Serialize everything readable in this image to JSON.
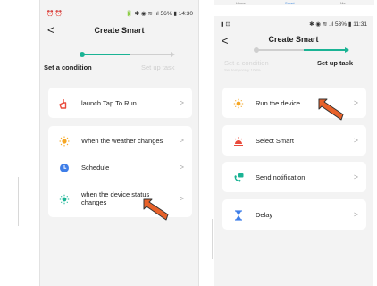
{
  "top_nav": {
    "home": "Home",
    "smart": "Smart",
    "me": "Me"
  },
  "left_phone": {
    "status_left": "⏰ ⏰",
    "status_right": "🔋 ✱ ◉ ≋ .ıl 56% ▮ 14:30",
    "back_glyph": "<",
    "title": "Create Smart",
    "steps": {
      "step1": "Set a condition",
      "step2": "Set up task"
    },
    "cards": [
      {
        "items": [
          {
            "label": "launch Tap To Run",
            "icon": "tap-hand-icon"
          }
        ]
      },
      {
        "items": [
          {
            "label": "When the weather changes",
            "icon": "sun-icon"
          },
          {
            "label": "Schedule",
            "icon": "clock-icon"
          },
          {
            "label": "when the device status changes",
            "icon": "device-icon"
          }
        ]
      }
    ],
    "chevron": ">"
  },
  "right_phone": {
    "status_left": "▮ ⊡",
    "status_right": "✱ ◉ ≋ .ıl 53% ▮ 11:31",
    "back_glyph": "<",
    "title": "Create Smart",
    "steps": {
      "step1": "Set a condition",
      "step1_sub": "Set temporary 100%",
      "step2": "Set up task"
    },
    "cards": [
      {
        "label": "Run the device",
        "icon": "device-icon"
      },
      {
        "label": "Select Smart",
        "icon": "smart-scene-icon"
      },
      {
        "label": "Send notification",
        "icon": "notification-icon"
      },
      {
        "label": "Delay",
        "icon": "hourglass-icon"
      }
    ],
    "chevron": ">"
  },
  "colors": {
    "accent": "#1ab394",
    "orange": "#f5a623",
    "red": "#e94b3c",
    "blue": "#3f7ee8",
    "pointer": "#e8622a",
    "muted": "#cfcfcf"
  }
}
